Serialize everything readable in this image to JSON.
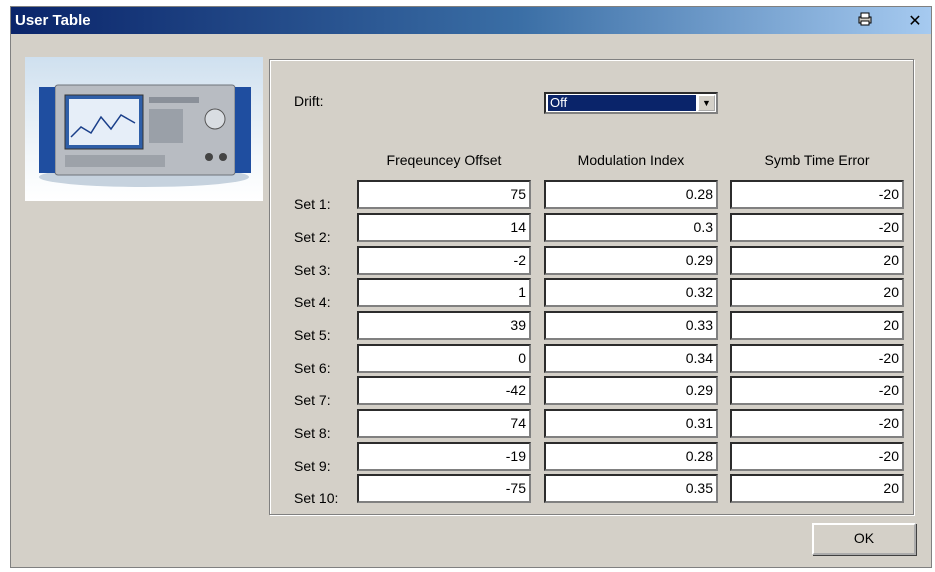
{
  "window": {
    "title": "User Table"
  },
  "drift": {
    "label": "Drift:",
    "value": "Off"
  },
  "columns": [
    "Freqeuncey Offset",
    "Modulation Index",
    "Symb Time Error"
  ],
  "rows": [
    {
      "label": "Set 1:",
      "values": [
        "75",
        "0.28",
        "-20"
      ]
    },
    {
      "label": "Set 2:",
      "values": [
        "14",
        "0.3",
        "-20"
      ]
    },
    {
      "label": "Set 3:",
      "values": [
        "-2",
        "0.29",
        "20"
      ]
    },
    {
      "label": "Set 4:",
      "values": [
        "1",
        "0.32",
        "20"
      ]
    },
    {
      "label": "Set 5:",
      "values": [
        "39",
        "0.33",
        "20"
      ]
    },
    {
      "label": "Set 6:",
      "values": [
        "0",
        "0.34",
        "-20"
      ]
    },
    {
      "label": "Set 7:",
      "values": [
        "-42",
        "0.29",
        "-20"
      ]
    },
    {
      "label": "Set 8:",
      "values": [
        "74",
        "0.31",
        "-20"
      ]
    },
    {
      "label": "Set 9:",
      "values": [
        "-19",
        "0.28",
        "-20"
      ]
    },
    {
      "label": "Set 10:",
      "values": [
        "-75",
        "0.35",
        "20"
      ]
    }
  ],
  "buttons": {
    "ok": "OK"
  },
  "icons": {
    "print": "printer-icon",
    "close": "close-icon"
  }
}
